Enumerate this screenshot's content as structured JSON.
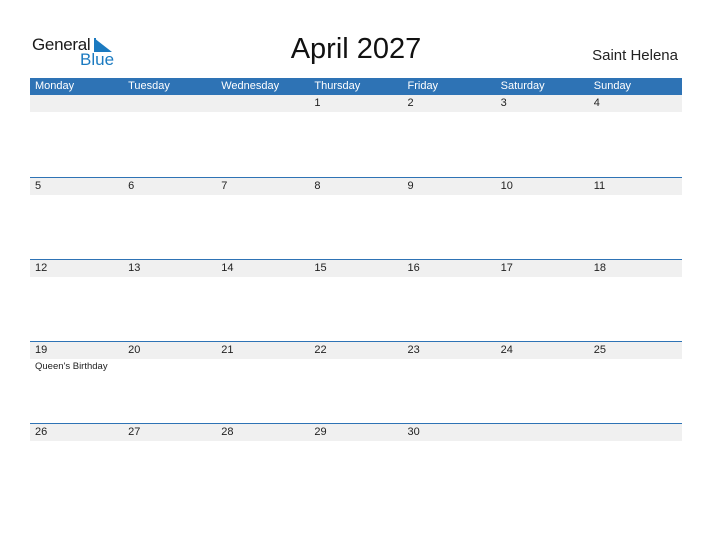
{
  "logo": {
    "text_top": "General",
    "text_bottom": "Blue",
    "icon": "triangle-flag-icon",
    "brand_color": "#1b7ac0"
  },
  "title": "April 2027",
  "country": "Saint Helena",
  "header_color": "#2e73b5",
  "weekdays": [
    "Monday",
    "Tuesday",
    "Wednesday",
    "Thursday",
    "Friday",
    "Saturday",
    "Sunday"
  ],
  "weeks": [
    {
      "days": [
        "",
        "",
        "",
        "1",
        "2",
        "3",
        "4"
      ],
      "events": [
        "",
        "",
        "",
        "",
        "",
        "",
        ""
      ]
    },
    {
      "days": [
        "5",
        "6",
        "7",
        "8",
        "9",
        "10",
        "11"
      ],
      "events": [
        "",
        "",
        "",
        "",
        "",
        "",
        ""
      ]
    },
    {
      "days": [
        "12",
        "13",
        "14",
        "15",
        "16",
        "17",
        "18"
      ],
      "events": [
        "",
        "",
        "",
        "",
        "",
        "",
        ""
      ]
    },
    {
      "days": [
        "19",
        "20",
        "21",
        "22",
        "23",
        "24",
        "25"
      ],
      "events": [
        "Queen's Birthday",
        "",
        "",
        "",
        "",
        "",
        ""
      ]
    },
    {
      "days": [
        "26",
        "27",
        "28",
        "29",
        "30",
        "",
        ""
      ],
      "events": [
        "",
        "",
        "",
        "",
        "",
        "",
        ""
      ]
    }
  ]
}
